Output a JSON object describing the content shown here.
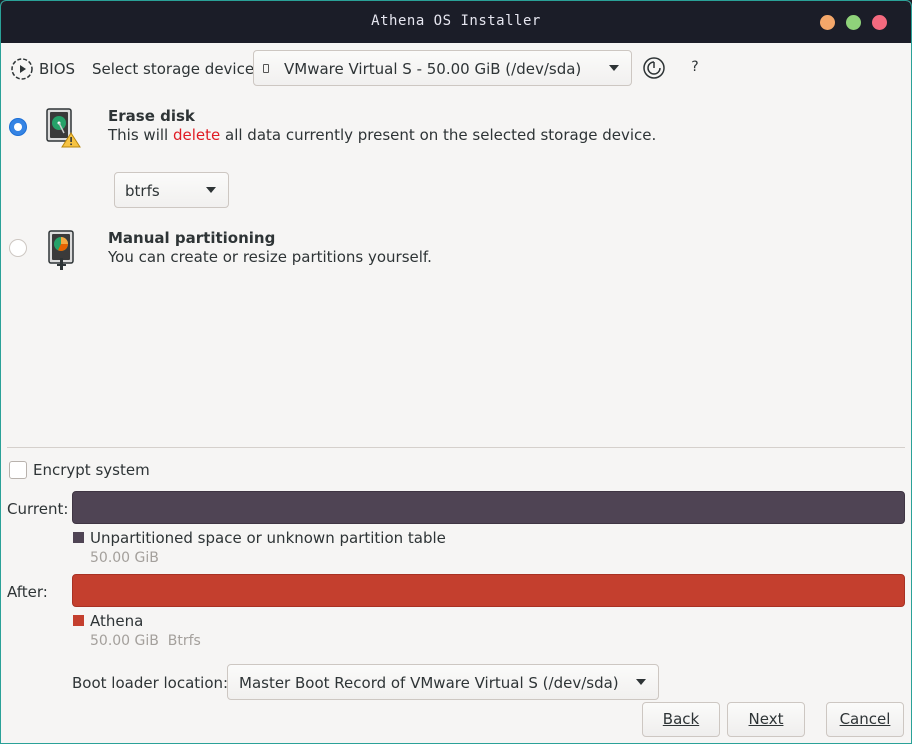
{
  "window": {
    "title": "Athena OS Installer"
  },
  "topbar": {
    "bios_label": "BIOS",
    "storage_label": "Select storage device:",
    "storage_value": "VMware Virtual S - 50.00 GiB (/dev/sda)",
    "help_label": "?"
  },
  "options": {
    "erase": {
      "title": "Erase disk",
      "desc_prefix": "This will ",
      "desc_highlight": "delete",
      "desc_suffix": " all data currently present on the selected storage device.",
      "selected": true
    },
    "filesystem": {
      "value": "btrfs"
    },
    "manual": {
      "title": "Manual partitioning",
      "desc": "You can create or resize partitions yourself.",
      "selected": false
    }
  },
  "encrypt": {
    "label": "Encrypt system",
    "checked": false
  },
  "partitions": {
    "current": {
      "label": "Current:",
      "color": "#4f4454",
      "name": "Unpartitioned space or unknown partition table",
      "size": "50.00 GiB"
    },
    "after": {
      "label": "After:",
      "color": "#c43f2e",
      "name": "Athena",
      "size": "50.00 GiB  Btrfs"
    }
  },
  "bootloader": {
    "label": "Boot loader location:",
    "value": "Master Boot Record of VMware Virtual S (/dev/sda)"
  },
  "buttons": {
    "back": "Back",
    "next": "Next",
    "cancel": "Cancel"
  },
  "colors": {
    "accent": "#3584e4",
    "titlebar": "#1b1d28",
    "warning": "#e01b24"
  },
  "icons": {
    "bios": "play-circle-icon",
    "refresh": "partition-refresh-icon",
    "erase": "hard-disk-warning-icon",
    "manual": "hard-disk-partition-icon"
  }
}
